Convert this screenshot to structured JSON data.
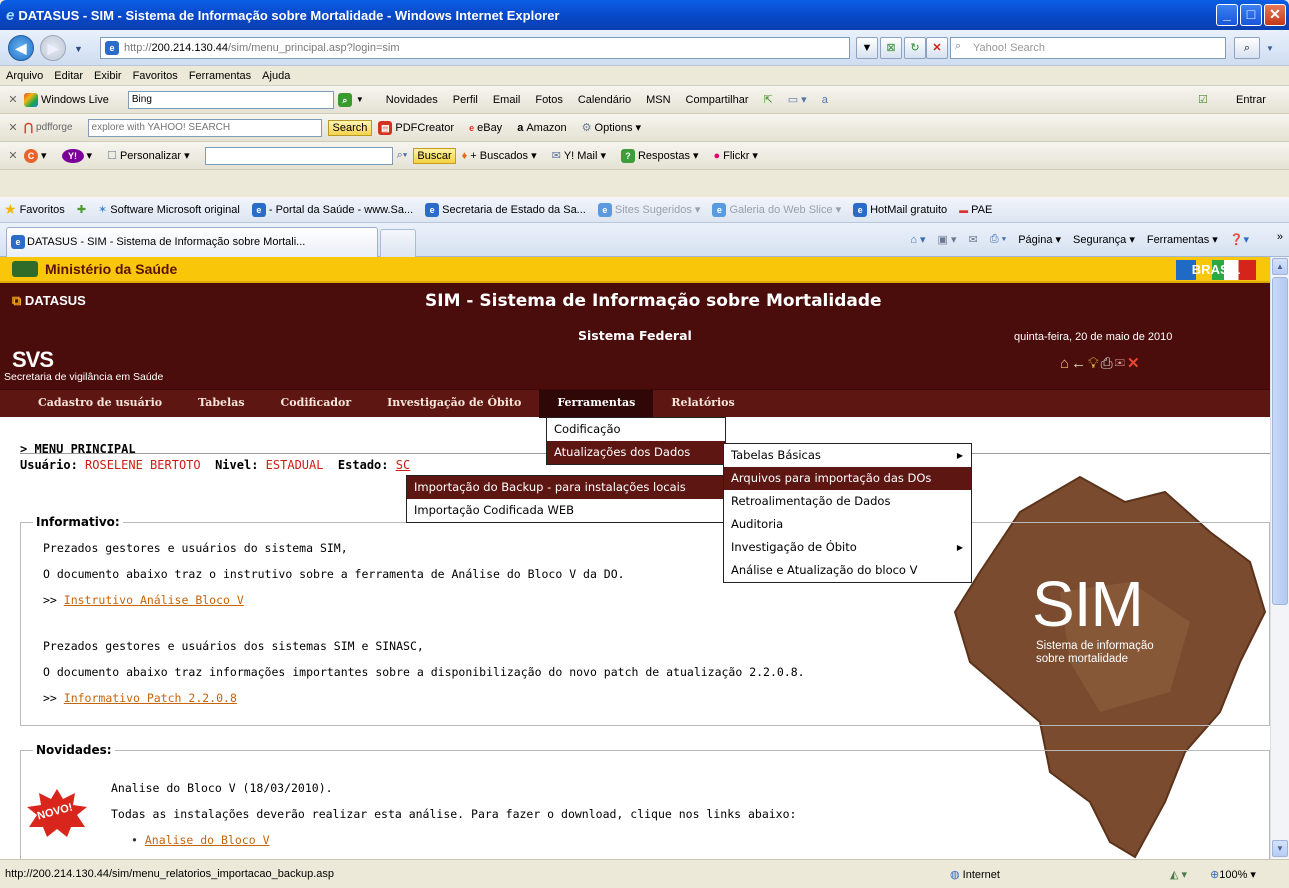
{
  "window": {
    "title": "DATASUS - SIM - Sistema de Informação sobre Mortalidade - Windows Internet Explorer"
  },
  "address": {
    "protocol": "http://",
    "host": "200.214.130.44",
    "path": "/sim/menu_principal.asp?login=sim",
    "search_placeholder": "Yahoo! Search"
  },
  "menubar": [
    "Arquivo",
    "Editar",
    "Exibir",
    "Favoritos",
    "Ferramentas",
    "Ajuda"
  ],
  "toolbar_live": {
    "brand": "Windows Live",
    "search_value": "Bing",
    "links": [
      "Novidades",
      "Perfil",
      "Email",
      "Fotos",
      "Calendário",
      "MSN",
      "Compartilhar"
    ],
    "signin": "Entrar"
  },
  "toolbar_pdf": {
    "brand": "pdfforge",
    "search_placeholder": "explore with YAHOO! SEARCH",
    "search_button": "Search",
    "links": [
      "PDFCreator",
      "eBay",
      "Amazon",
      "Options"
    ]
  },
  "toolbar_yahoo": {
    "personalize": "Personalizar",
    "buscar": "Buscar",
    "links": [
      "+ Buscados",
      "Y! Mail",
      "Respostas",
      "Flickr"
    ]
  },
  "favorites": {
    "label": "Favoritos",
    "items": [
      {
        "label": "Software Microsoft original",
        "grey": false
      },
      {
        "label": "- Portal da Saúde - www.Sa...",
        "grey": false
      },
      {
        "label": "Secretaria de Estado da Sa...",
        "grey": false
      },
      {
        "label": "Sites Sugeridos",
        "grey": true
      },
      {
        "label": "Galeria do Web Slice",
        "grey": true
      },
      {
        "label": "HotMail gratuito",
        "grey": false
      },
      {
        "label": "PAE",
        "grey": false
      }
    ]
  },
  "tab": {
    "label": "DATASUS - SIM - Sistema de Informação sobre Mortali...",
    "commands": [
      "Página",
      "Segurança",
      "Ferramentas"
    ]
  },
  "header": {
    "ministry": "Ministério da Saúde",
    "brasil_logo": "BRASIL",
    "datasus": "DATASUS",
    "title": "SIM - Sistema de Informação sobre Mortalidade",
    "subtitle": "Sistema Federal",
    "svs_logo": "SVS",
    "svs_text": "Secretaria de vigilância em Saúde",
    "date": "quinta-feira, 20 de maio de 2010"
  },
  "nav": [
    "Cadastro de usuário",
    "Tabelas",
    "Codificador",
    "Investigação de Óbito",
    "Ferramentas",
    "Relatórios"
  ],
  "nav_active": "Ferramentas",
  "menu_principal": "> MENU PRINCIPAL",
  "user": {
    "usuario_label": "Usuário:",
    "usuario": "ROSELENE BERTOTO",
    "nivel_label": "Nivel:",
    "nivel": "ESTADUAL",
    "estado_label": "Estado:",
    "estado": "SC"
  },
  "informativo": {
    "legend": "Informativo:",
    "line1": "Prezados gestores e usuários do sistema SIM,",
    "line2": "O documento abaixo traz o instrutivo sobre a ferramenta de Análise do Bloco V da DO.",
    "link1_prefix": ">> ",
    "link1": "Instrutivo Análise Bloco V",
    "line3": "Prezados gestores e usuários dos sistemas SIM e SINASC,",
    "line4": "O documento abaixo traz informações importantes sobre a disponibilização do novo patch de atualização 2.2.0.8.",
    "link2_prefix": ">> ",
    "link2": "Informativo Patch 2.2.0.8"
  },
  "novidades": {
    "legend": "Novidades:",
    "badge": "NOVO!",
    "line1": "Analise do Bloco V (18/03/2010).",
    "line2": "Todas as instalações deverão realizar esta análise. Para fazer o download, clique nos links abaixo:",
    "link1": "Analise do Bloco V"
  },
  "sim_logo": {
    "word": "SIM",
    "sub1": "Sistema de informação",
    "sub2": "sobre mortalidade"
  },
  "menus": {
    "ferramentas": [
      "Codificação",
      "Atualizações dos Dados"
    ],
    "atualizacoes": [
      "Tabelas Básicas",
      "Arquivos para importação das DOs",
      "Retroalimentação de Dados",
      "Auditoria",
      "Investigação de Óbito",
      "Análise e Atualização do bloco V"
    ],
    "importacao": [
      "Importação do Backup - para instalações locais",
      "Importação Codificada WEB"
    ]
  },
  "status": {
    "url": "http://200.214.130.44/sim/menu_relatorios_importacao_backup.asp",
    "zone": "Internet",
    "zoom": "100%"
  },
  "colors": {
    "maroon": "#4B0D0C",
    "nav": "#5E1613",
    "ministry_bar": "#F9C60A",
    "link": "#C5650C",
    "user_value": "#D01C13"
  }
}
